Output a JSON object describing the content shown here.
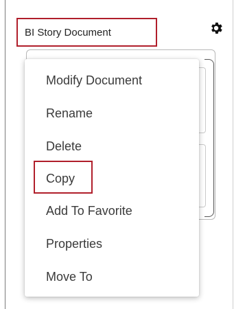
{
  "document": {
    "title": "BI Story Document"
  },
  "toolbar": {
    "settings_icon": "gear-icon"
  },
  "context_menu": {
    "items": [
      {
        "label": "Modify Document"
      },
      {
        "label": "Rename"
      },
      {
        "label": "Delete"
      },
      {
        "label": "Copy",
        "highlighted": true
      },
      {
        "label": "Add To Favorite"
      },
      {
        "label": "Properties"
      },
      {
        "label": "Move To"
      }
    ]
  },
  "colors": {
    "highlight_border": "#b01e2a",
    "menu_text": "#3a3a3a"
  }
}
